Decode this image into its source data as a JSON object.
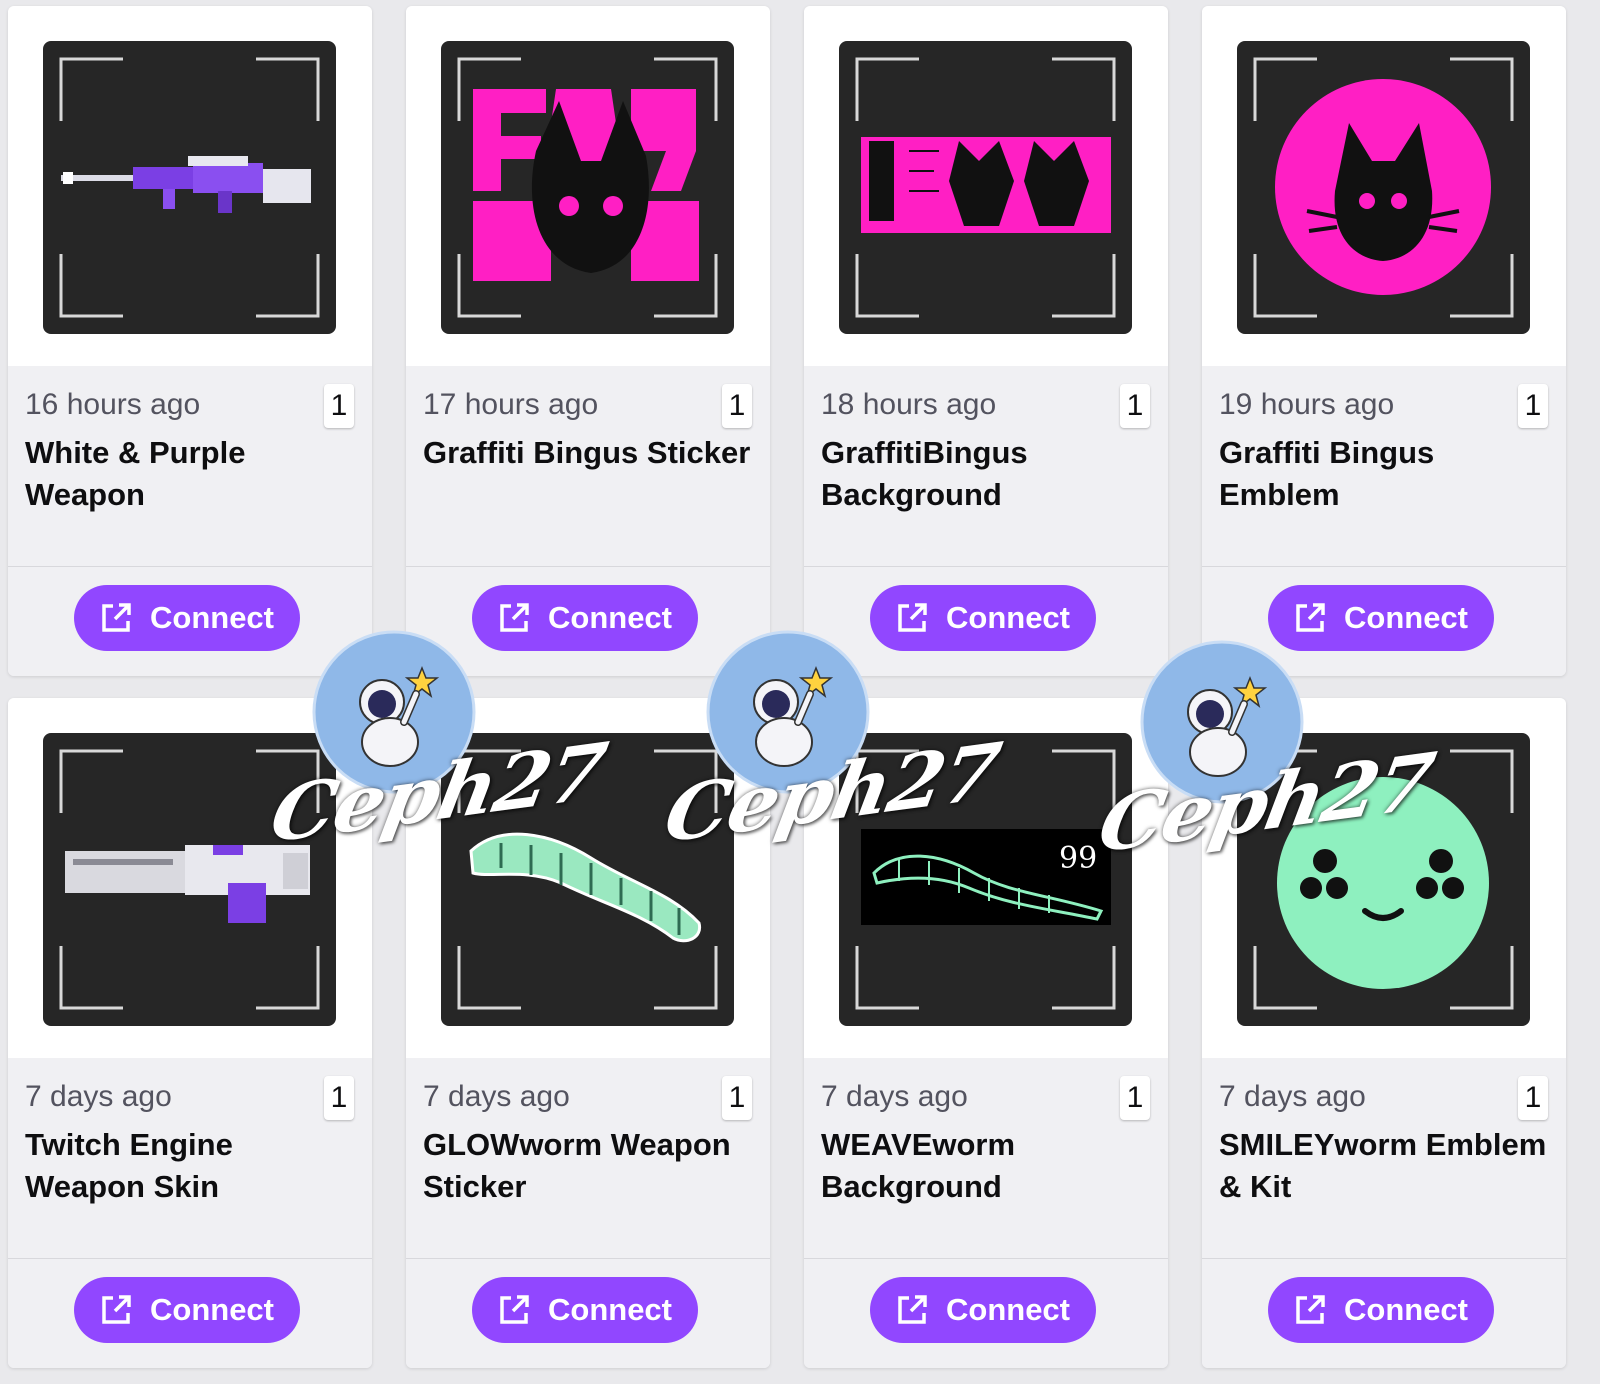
{
  "connect_label": "Connect",
  "colors": {
    "accent": "#9147ff",
    "tile_bg": "#262626",
    "magenta": "#ff1fc4",
    "mint": "#8ef0bf"
  },
  "cards": [
    {
      "time": "16 hours ago",
      "qty": "1",
      "title": "White & Purple Weapon",
      "art": "purple-sniper-rifle"
    },
    {
      "time": "17 hours ago",
      "qty": "1",
      "title": "Graffiti Bingus Sticker",
      "art": "pink-graffiti-cat-sticker"
    },
    {
      "time": "18 hours ago",
      "qty": "1",
      "title": "GraffitiBingus Background",
      "art": "pink-graffiti-banner"
    },
    {
      "time": "19 hours ago",
      "qty": "1",
      "title": "Graffiti Bingus Emblem",
      "art": "pink-circle-cat-emblem"
    },
    {
      "time": "7 days ago",
      "qty": "1",
      "title": "Twitch Engine Weapon Skin",
      "art": "white-purple-smg"
    },
    {
      "time": "7 days ago",
      "qty": "1",
      "title": "GLOWworm Weapon Sticker",
      "art": "green-caterpillar-sticker"
    },
    {
      "time": "7 days ago",
      "qty": "1",
      "title": "WEAVEworm Background",
      "art": "caterpillar-banner",
      "banner_number": "99"
    },
    {
      "time": "7 days ago",
      "qty": "1",
      "title": "SMILEYworm Emblem & Kit",
      "art": "mint-smiley-emblem"
    }
  ],
  "watermark": {
    "text": "Ceph27",
    "icon": "astronaut-star-badge"
  }
}
